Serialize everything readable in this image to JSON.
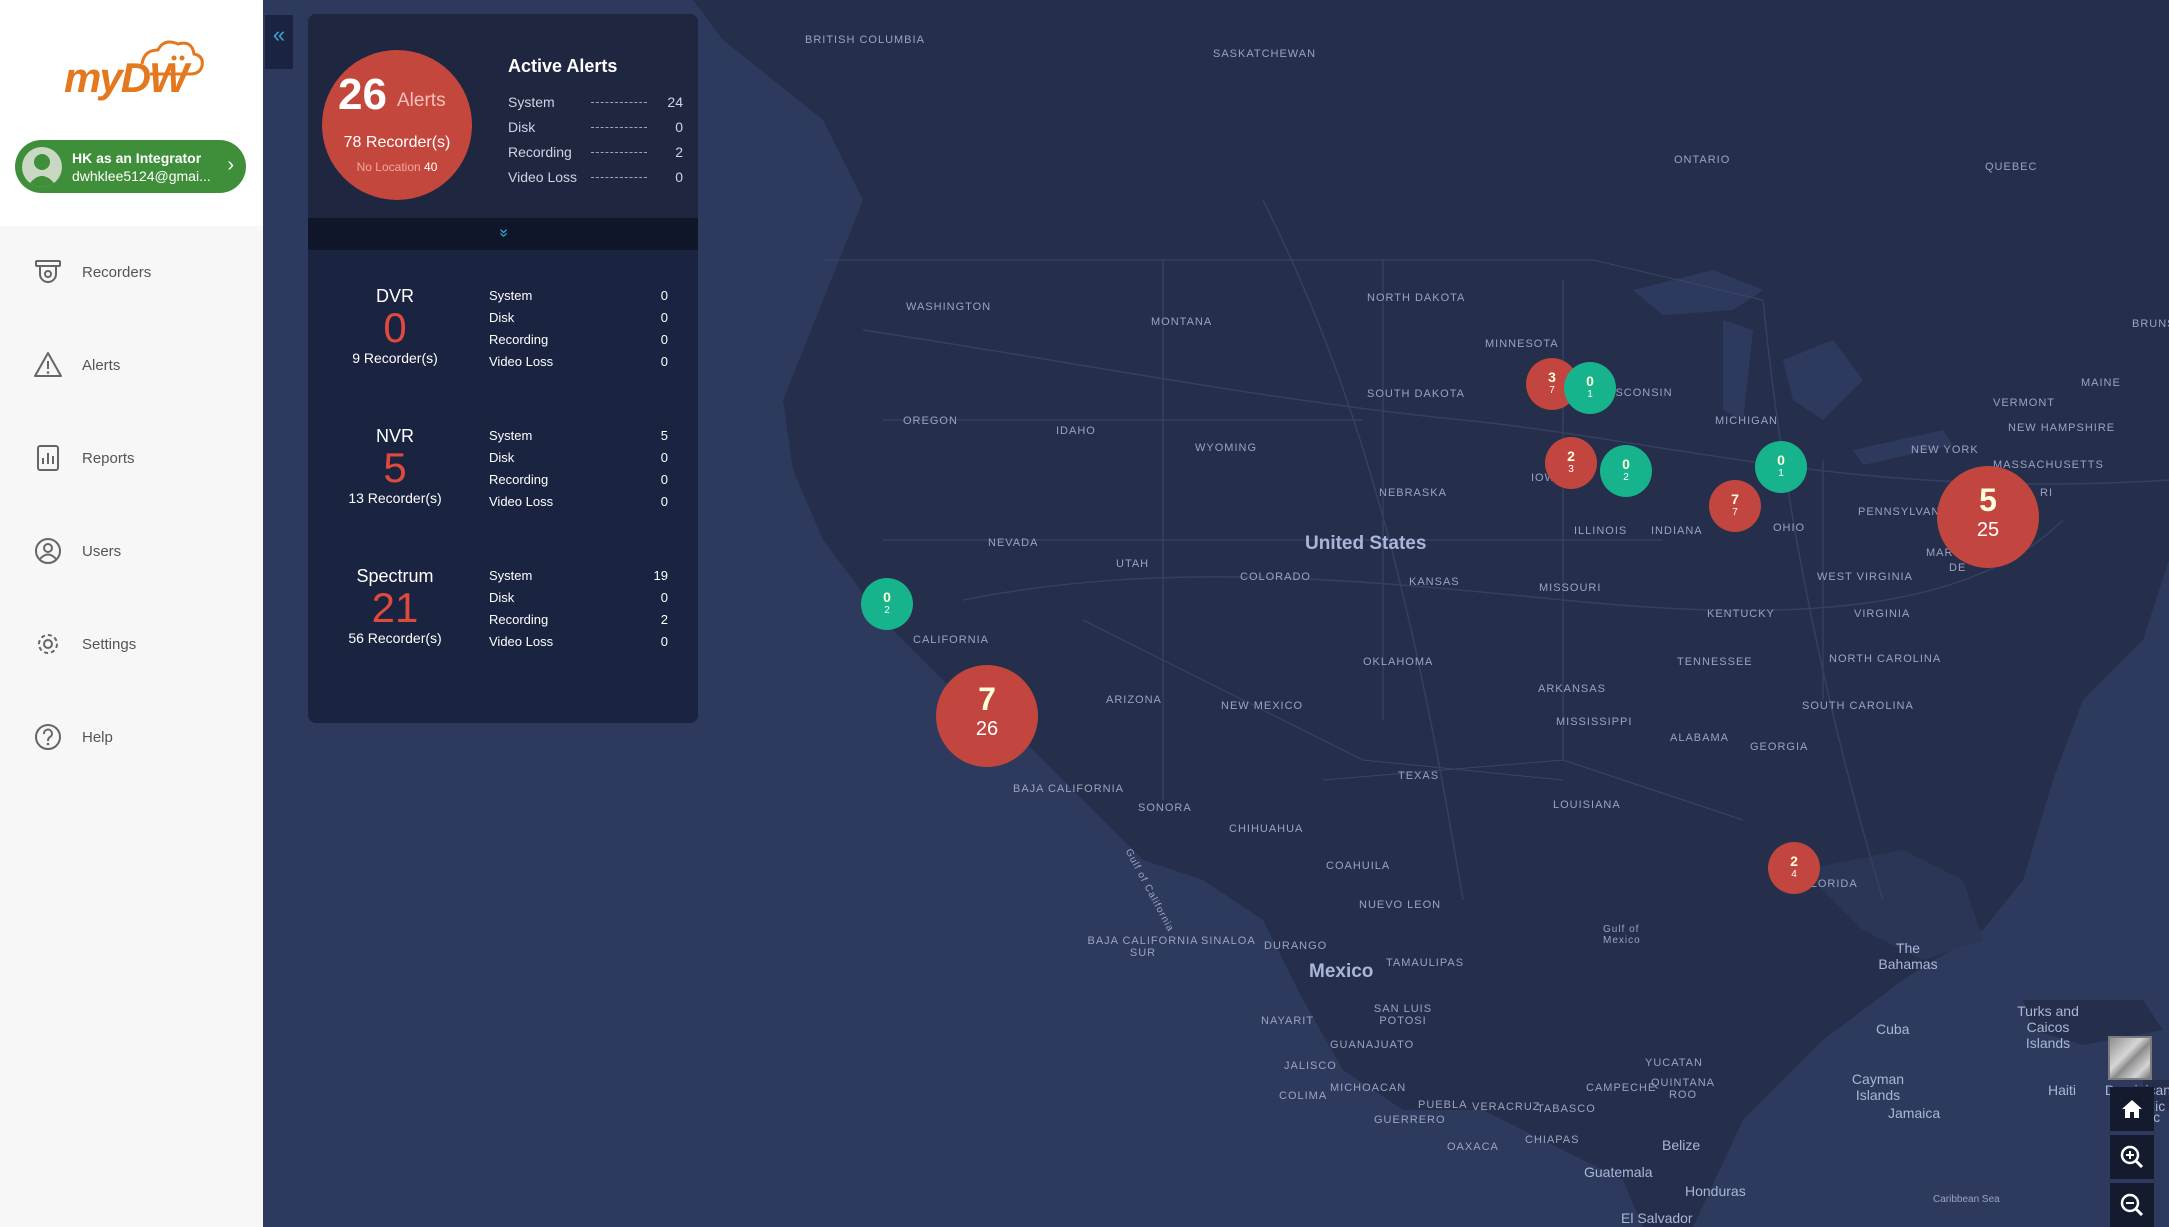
{
  "app": {
    "logo_text": "myDW"
  },
  "user": {
    "name": "HK as an Integrator",
    "email": "dwhklee5124@gmai..."
  },
  "nav": {
    "items": [
      {
        "label": "Recorders",
        "icon": "recorder-icon"
      },
      {
        "label": "Alerts",
        "icon": "alert-triangle-icon"
      },
      {
        "label": "Reports",
        "icon": "report-chart-icon"
      },
      {
        "label": "Users",
        "icon": "user-circle-icon"
      },
      {
        "label": "Settings",
        "icon": "gear-icon"
      },
      {
        "label": "Help",
        "icon": "help-circle-icon"
      }
    ]
  },
  "collapse_glyph": "«",
  "summary": {
    "total": "26",
    "total_label": "Alerts",
    "recorders": "78 Recorder(s)",
    "no_location_label": "No Location",
    "no_location_count": "40",
    "title": "Active Alerts",
    "rows": [
      {
        "label": "System",
        "value": "24"
      },
      {
        "label": "Disk",
        "value": "0"
      },
      {
        "label": "Recording",
        "value": "2"
      },
      {
        "label": "Video Loss",
        "value": "0"
      }
    ],
    "expand_glyph": "»"
  },
  "groups": [
    {
      "name": "DVR",
      "count": "0",
      "recorders": "9 Recorder(s)",
      "rows": [
        {
          "label": "System",
          "value": "0"
        },
        {
          "label": "Disk",
          "value": "0"
        },
        {
          "label": "Recording",
          "value": "0"
        },
        {
          "label": "Video Loss",
          "value": "0"
        }
      ]
    },
    {
      "name": "NVR",
      "count": "5",
      "recorders": "13 Recorder(s)",
      "rows": [
        {
          "label": "System",
          "value": "5"
        },
        {
          "label": "Disk",
          "value": "0"
        },
        {
          "label": "Recording",
          "value": "0"
        },
        {
          "label": "Video Loss",
          "value": "0"
        }
      ]
    },
    {
      "name": "Spectrum",
      "count": "21",
      "recorders": "56 Recorder(s)",
      "rows": [
        {
          "label": "System",
          "value": "19"
        },
        {
          "label": "Disk",
          "value": "0"
        },
        {
          "label": "Recording",
          "value": "2"
        },
        {
          "label": "Video Loss",
          "value": "0"
        }
      ]
    }
  ],
  "map": {
    "labels": {
      "british_columbia": "BRITISH COLUMBIA",
      "saskatchewan": "SASKATCHEWAN",
      "ontario": "ONTARIO",
      "quebec": "QUEBEC",
      "brunswick": "BRUNS",
      "washington": "WASHINGTON",
      "montana": "MONTANA",
      "north_dakota": "NORTH DAKOTA",
      "minnesota": "MINNESOTA",
      "maine": "MAINE",
      "vermont": "VERMONT",
      "new_hampshire": "NEW HAMPSHIRE",
      "massachusetts": "MASSACHUSETTS",
      "oregon": "OREGON",
      "idaho": "IDAHO",
      "wyoming": "WYOMING",
      "south_dakota": "SOUTH DAKOTA",
      "wisconsin": "WISCONSIN",
      "michigan": "MICHIGAN",
      "new_york": "NEW YORK",
      "ct": "CT",
      "ri": "RI",
      "iowa": "IOWA",
      "nebraska": "NEBRASKA",
      "illinois": "ILLINOIS",
      "indiana": "INDIANA",
      "ohio": "OHIO",
      "pennsylvania": "PENNSYLVANIA",
      "nevada": "NEVADA",
      "utah": "UTAH",
      "united_states": "United States",
      "maryland": "MARYLAND",
      "de": "DE",
      "nj": "N",
      "colorado": "COLORADO",
      "kansas": "KANSAS",
      "missouri": "MISSOURI",
      "west_virginia": "WEST VIRGINIA",
      "virginia": "VIRGINIA",
      "kentucky": "KENTUCKY",
      "california": "CALIFORNIA",
      "tennessee": "TENNESSEE",
      "north_carolina": "NORTH CAROLINA",
      "oklahoma": "OKLAHOMA",
      "arkansas": "ARKANSAS",
      "arizona": "ARIZONA",
      "new_mexico": "NEW MEXICO",
      "south_carolina": "SOUTH CAROLINA",
      "mississippi": "MISSISSIPPI",
      "alabama": "ALABAMA",
      "georgia": "GEORGIA",
      "texas": "TEXAS",
      "baja_california": "BAJA CALIFORNIA",
      "louisiana": "LOUISIANA",
      "sonora": "SONORA",
      "chihuahua": "CHIHUAHUA",
      "florida": "FLORIDA",
      "gulf_of_california": "Gulf of California",
      "coahuila": "COAHUILA",
      "nuevo_leon": "NUEVO LEON",
      "gulf_of_mexico": "Gulf of Mexico",
      "baja_california_sur": "BAJA CALIFORNIA SUR",
      "sinaloa": "SINALOA",
      "durango": "DURANGO",
      "the_bahamas": "The Bahamas",
      "mexico": "Mexico",
      "tamaulipas": "TAMAULIPAS",
      "san_luis_potosi": "SAN LUIS POTOSI",
      "nayarit": "NAYARIT",
      "turks_and_caicos": "Turks and Caicos Islands",
      "cuba": "Cuba",
      "guanajuato": "GUANAJUATO",
      "jalisco": "JALISCO",
      "yucatan": "YUCATAN",
      "colima": "COLIMA",
      "michoacan": "MICHOACAN",
      "cayman_islands": "Cayman Islands",
      "campeche": "CAMPECHE",
      "quintana_roo": "QUINTANA ROO",
      "haiti": "Haiti",
      "dominican_republic": "Dominican Republic",
      "puebla": "PUEBLA",
      "veracruz": "VERACRUZ",
      "tabasco": "TABASCO",
      "guerrero": "GUERRERO",
      "jamaica": "Jamaica",
      "ic": "ic",
      "oaxaca": "OAXACA",
      "chiapas": "CHIAPAS",
      "belize": "Belize",
      "guatemala": "Guatemala",
      "honduras": "Honduras",
      "caribbean_sea": "Caribbean Sea",
      "el_salvador": "El Salvador"
    },
    "clusters": [
      {
        "color": "red",
        "top": "7",
        "bottom": "26"
      },
      {
        "color": "red",
        "top": "5",
        "bottom": "25"
      },
      {
        "color": "green",
        "top": "0",
        "bottom": "2"
      },
      {
        "color": "red",
        "top": "3",
        "bottom": "7"
      },
      {
        "color": "green",
        "top": "0",
        "bottom": "1"
      },
      {
        "color": "red",
        "top": "2",
        "bottom": "3"
      },
      {
        "color": "green",
        "top": "0",
        "bottom": "2"
      },
      {
        "color": "green",
        "top": "0",
        "bottom": "1"
      },
      {
        "color": "red",
        "top": "7",
        "bottom": "7"
      },
      {
        "color": "red",
        "top": "2",
        "bottom": "4"
      }
    ]
  },
  "map_controls": {
    "basemap": "satellite-thumbnail-icon",
    "home": "home-icon",
    "zoom_in": "zoom-in-icon",
    "zoom_out": "zoom-out-icon"
  }
}
